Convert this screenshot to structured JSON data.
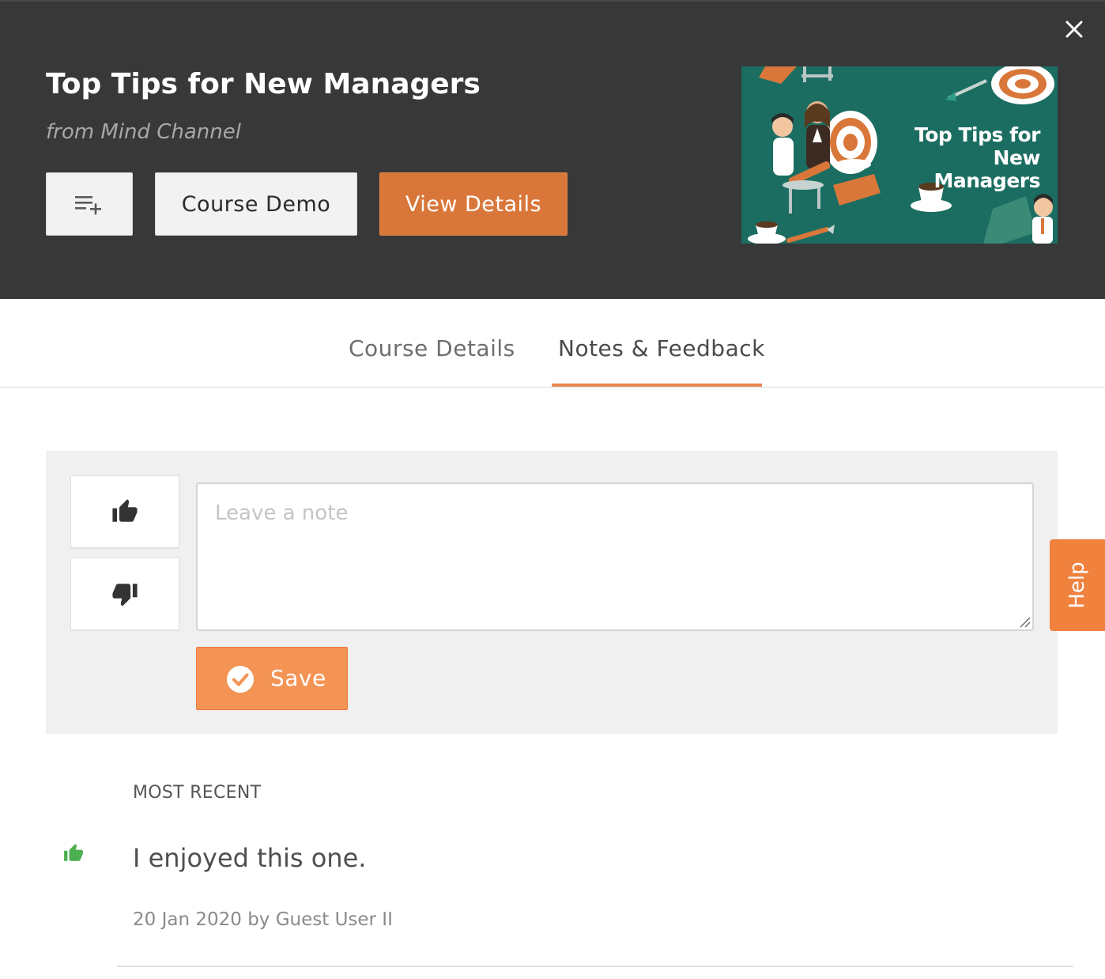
{
  "course": {
    "title": "Top Tips for New Managers",
    "source": "from Mind Channel",
    "thumbnail_title_line1": "Top Tips for",
    "thumbnail_title_line2": "New Managers"
  },
  "header": {
    "close_icon": "close-icon",
    "playlist_icon": "playlist-add-icon",
    "demo_label": "Course Demo",
    "details_label": "View Details"
  },
  "tabs": [
    {
      "label": "Course Details",
      "active": false
    },
    {
      "label": "Notes & Feedback",
      "active": true
    }
  ],
  "note_form": {
    "placeholder": "Leave a note",
    "value": "",
    "like_icon": "thumbs-up-icon",
    "dislike_icon": "thumbs-down-icon",
    "save_label": "Save",
    "save_icon": "check-circle-icon"
  },
  "help": {
    "label": "Help"
  },
  "feedback": {
    "section_label": "MOST RECENT",
    "items": [
      {
        "sentiment": "positive",
        "icon": "thumbs-up-icon",
        "text": "I enjoyed this one.",
        "meta": "20 Jan 2020 by Guest User II"
      }
    ]
  },
  "colors": {
    "header_bg": "#383838",
    "accent_orange": "#d9773a",
    "save_orange": "#f49454",
    "help_orange": "#f0823e",
    "tab_underline": "#e8864f",
    "panel_bg": "#f0f0f0",
    "positive_green": "#4caf50",
    "thumbnail_bg": "#1b6d61"
  }
}
